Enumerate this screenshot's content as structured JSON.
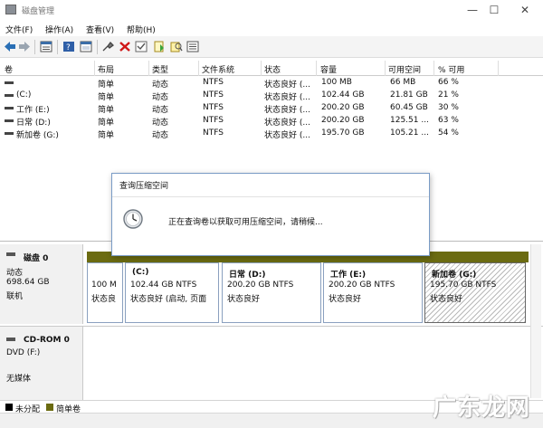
{
  "window": {
    "title": "磁盘管理",
    "controls": {
      "minimize": "—",
      "maximize": "☐",
      "close": "✕"
    }
  },
  "menu": [
    "文件(F)",
    "操作(A)",
    "查看(V)",
    "帮助(H)"
  ],
  "toolbar_icons": [
    "back-icon",
    "forward-icon",
    "properties-icon",
    "help-icon",
    "console-icon",
    "connect-icon",
    "delete-icon",
    "check-icon",
    "new-icon",
    "search-icon",
    "list-icon"
  ],
  "volumes": {
    "columns": [
      "卷",
      "布局",
      "类型",
      "文件系统",
      "状态",
      "容量",
      "可用空间",
      "% 可用"
    ],
    "rows": [
      {
        "name": "",
        "layout": "简单",
        "type": "动态",
        "fs": "NTFS",
        "status": "状态良好 (...",
        "capacity": "100 MB",
        "free": "66 MB",
        "pct": "66 %"
      },
      {
        "name": "(C:)",
        "layout": "简单",
        "type": "动态",
        "fs": "NTFS",
        "status": "状态良好 (...",
        "capacity": "102.44 GB",
        "free": "21.81 GB",
        "pct": "21 %"
      },
      {
        "name": "工作 (E:)",
        "layout": "简单",
        "type": "动态",
        "fs": "NTFS",
        "status": "状态良好 (...",
        "capacity": "200.20 GB",
        "free": "60.45 GB",
        "pct": "30 %"
      },
      {
        "name": "日常 (D:)",
        "layout": "简单",
        "type": "动态",
        "fs": "NTFS",
        "status": "状态良好 (...",
        "capacity": "200.20 GB",
        "free": "125.51 ...",
        "pct": "63 %"
      },
      {
        "name": "新加卷 (G:)",
        "layout": "简单",
        "type": "动态",
        "fs": "NTFS",
        "status": "状态良好 (...",
        "capacity": "195.70 GB",
        "free": "105.21 ...",
        "pct": "54 %"
      }
    ]
  },
  "dialog": {
    "title": "查询压缩空间",
    "message": "正在查询卷以获取可用压缩空间，请稍候..."
  },
  "disk0": {
    "name": "磁盘 0",
    "type": "动态",
    "size": "698.64 GB",
    "state": "联机",
    "partitions": [
      {
        "name": "",
        "size": "100 M",
        "status": "状态良"
      },
      {
        "name": "(C:)",
        "size": "102.44 GB NTFS",
        "status": "状态良好 (启动, 页面"
      },
      {
        "name": "日常  (D:)",
        "size": "200.20 GB NTFS",
        "status": "状态良好"
      },
      {
        "name": "工作  (E:)",
        "size": "200.20 GB NTFS",
        "status": "状态良好"
      },
      {
        "name": "新加卷  (G:)",
        "size": "195.70 GB NTFS",
        "status": "状态良好"
      }
    ]
  },
  "cdrom0": {
    "name": "CD-ROM 0",
    "type": "DVD (F:)",
    "state": "无媒体"
  },
  "legend": [
    {
      "label": "未分配",
      "color": "#000000"
    },
    {
      "label": "简单卷",
      "color": "#6b6b11"
    }
  ],
  "watermark": "广东龙网"
}
